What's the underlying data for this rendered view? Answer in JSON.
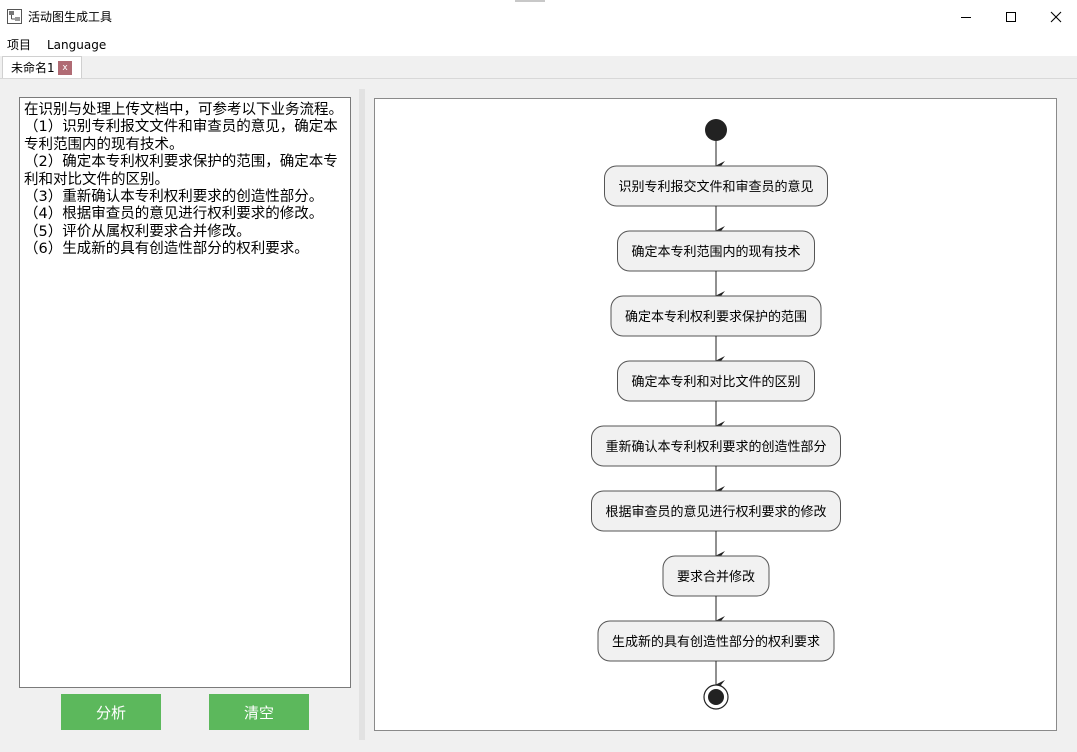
{
  "window": {
    "title": "活动图生成工具"
  },
  "menu": {
    "project": "项目",
    "language": "Language"
  },
  "tabs": [
    {
      "label": "未命名1",
      "close": "x"
    }
  ],
  "editor": {
    "text": "在识别与处理上传文档中，可参考以下业务流程。\n（1）识别专利报文文件和审查员的意见，确定本专利范围内的现有技术。\n（2）确定本专利权利要求保护的范围，确定本专利和对比文件的区别。\n（3）重新确认本专利权利要求的创造性部分。\n（4）根据审查员的意见进行权利要求的修改。\n（5）评价从属权利要求合并修改。\n（6）生成新的具有创造性部分的权利要求。"
  },
  "buttons": {
    "analyze": "分析",
    "clear": "清空"
  },
  "colors": {
    "button_green": "#5cb85c",
    "node_fill": "#f1f1f1",
    "tab_close": "#b06b74"
  },
  "diagram": {
    "steps": [
      "识别专利报交文件和审查员的意见",
      "确定本专利范围内的现有技术",
      "确定本专利权利要求保护的范围",
      "确定本专利和对比文件的区别",
      "重新确认本专利权利要求的创造性部分",
      "根据审查员的意见进行权利要求的修改",
      "要求合并修改",
      "生成新的具有创造性部分的权利要求"
    ]
  }
}
